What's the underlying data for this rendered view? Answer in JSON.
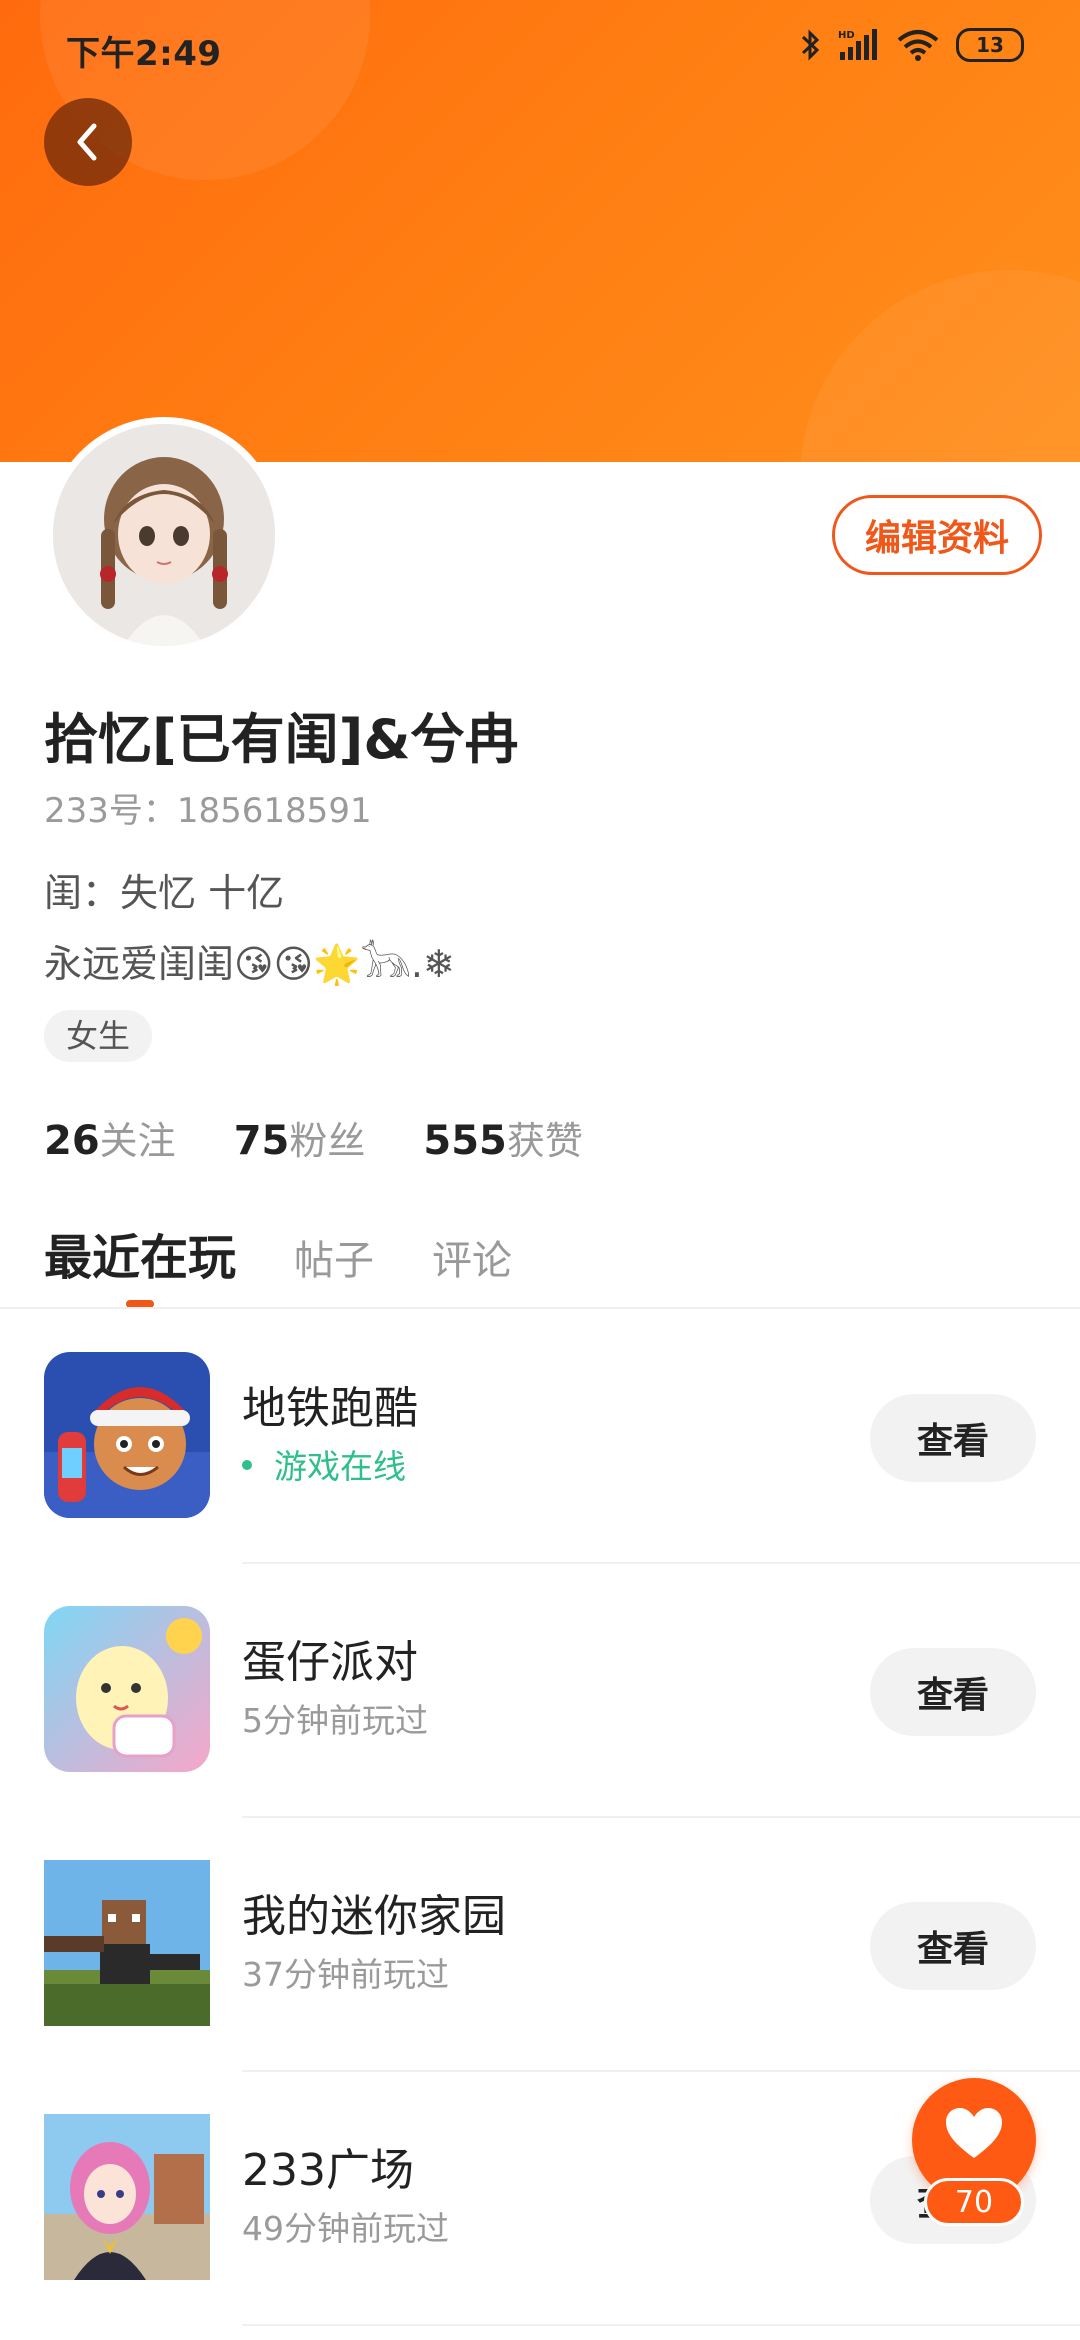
{
  "status_bar": {
    "time": "下午2:49",
    "battery": "13",
    "network_label": "HD"
  },
  "profile": {
    "nickname": "拾忆[已有闺]&兮冉",
    "uid_label": "233号：185618591",
    "bio_line1": "闺：失忆   十亿",
    "bio_line2": "永远爱闺闺😘😘🌟𓃥.❄",
    "gender": "女生",
    "edit_label": "编辑资料"
  },
  "stats": [
    {
      "count": "26",
      "label": "关注"
    },
    {
      "count": "75",
      "label": "粉丝"
    },
    {
      "count": "555",
      "label": "获赞"
    }
  ],
  "tabs": [
    {
      "label": "最近在玩",
      "active": true
    },
    {
      "label": "帖子",
      "active": false
    },
    {
      "label": "评论",
      "active": false
    }
  ],
  "games": [
    {
      "name": "地铁跑酷",
      "status": "游戏在线",
      "online": true,
      "action": "查看"
    },
    {
      "name": "蛋仔派对",
      "status": "5分钟前玩过",
      "online": false,
      "action": "查看"
    },
    {
      "name": "我的迷你家园",
      "status": "37分钟前玩过",
      "online": false,
      "action": "查看"
    },
    {
      "name": "233广场",
      "status": "49分钟前玩过",
      "online": false,
      "action": "查看"
    }
  ],
  "fab": {
    "count": "70",
    "icon": "heart-icon"
  },
  "colors": {
    "header": "#ff7d12",
    "accent": "#f0581a",
    "online": "#2fbf8b"
  }
}
